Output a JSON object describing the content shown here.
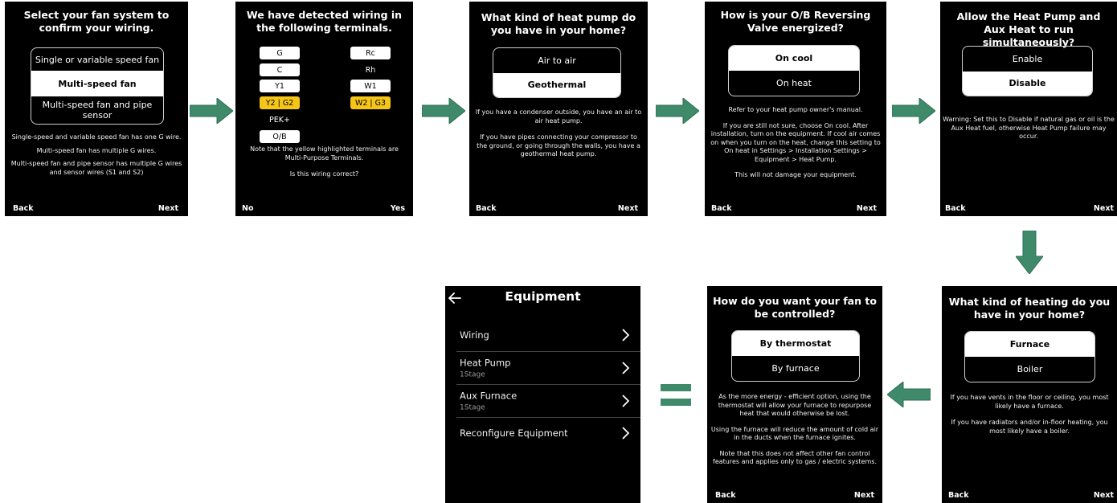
{
  "colors": {
    "arrow": "#3e8a6a",
    "highlight": "#f5c518",
    "background": "#000000"
  },
  "screen1": {
    "title": "Select your fan system to confirm your wiring.",
    "options": [
      "Single or variable speed fan",
      "Multi-speed fan",
      "Multi-speed fan and pipe sensor"
    ],
    "selected": "Multi-speed fan",
    "info": [
      "Single-speed and variable speed fan has one G wire.",
      "Multi-speed fan has multiple G wires.",
      "Multi-speed fan and pipe sensor has multiple G wires and sensor wires (S1 and S2)"
    ],
    "back": "Back",
    "next": "Next"
  },
  "screen2": {
    "title": "We have detected wiring in the following terminals.",
    "left_terminals": [
      "G",
      "C",
      "Y1",
      "Y2 | G2",
      "PEK+",
      "O/B"
    ],
    "right_terminals": [
      "Rc",
      "Rh",
      "W1",
      "W2 | G3"
    ],
    "note": "Note that the yellow highlighted terminals are Multi-Purpose Terminals.",
    "question": "Is this wiring correct?",
    "no": "No",
    "yes": "Yes"
  },
  "screen3": {
    "title": "What kind of heat pump do you have in your home?",
    "options": [
      "Air to air",
      "Geothermal"
    ],
    "selected": "Geothermal",
    "info": [
      "If you have a condenser outside, you have an air to air heat pump.",
      "If you have pipes connecting your compressor to the ground, or going through the walls, you have a geothermal heat pump."
    ],
    "back": "Back",
    "next": "Next"
  },
  "screen4": {
    "title": "How is your O/B Reversing Valve energized?",
    "options": [
      "On cool",
      "On heat"
    ],
    "selected": "On cool",
    "info": [
      "Refer to your heat pump owner's manual.",
      "If you are still not sure, choose On cool.  After installation, turn on the equipment.  If cool air comes on when you turn on the heat, change this setting to On heat in Settings > Installation Settings > Equipment > Heat Pump.",
      "This will not damage your equipment."
    ],
    "back": "Back",
    "next": "Next"
  },
  "screen5": {
    "title": "Allow the Heat Pump and Aux Heat to run simultaneously?",
    "options": [
      "Enable",
      "Disable"
    ],
    "selected": "Disable",
    "info": [
      "Warning:  Set this to Disable if natural gas or oil is the Aux Heat fuel, otherwise Heat Pump failure may occur."
    ],
    "back": "Back",
    "next": "Next"
  },
  "screen6": {
    "title": "What kind of heating do you have in your home?",
    "options": [
      "Furnace",
      "Boiler"
    ],
    "selected": "Furnace",
    "info": [
      "If you have vents in the floor or ceiling, you most likely have a furnace.",
      "If you have radiators and/or in-floor heating, you most likely have a boiler."
    ],
    "back": "Back",
    "next": "Next"
  },
  "screen7": {
    "title": "How do you want your fan to be controlled?",
    "options": [
      "By thermostat",
      "By furnace"
    ],
    "selected": "By thermostat",
    "info": [
      "As the more energy - efficient option, using the thermostat will allow your furnace to repurpose heat that would otherwise be lost.",
      "Using the furnace will reduce the amount of cold air in the ducts when the furnace ignites.",
      "Note that this does not affect other fan control features and applies only to gas / electric systems."
    ],
    "back": "Back",
    "next": "Next"
  },
  "equipment": {
    "title": "Equipment",
    "items": [
      {
        "label": "Wiring",
        "sub": ""
      },
      {
        "label": "Heat Pump",
        "sub": "1Stage"
      },
      {
        "label": "Aux Furnace",
        "sub": "1Stage"
      },
      {
        "label": "Reconfigure Equipment",
        "sub": ""
      }
    ]
  }
}
